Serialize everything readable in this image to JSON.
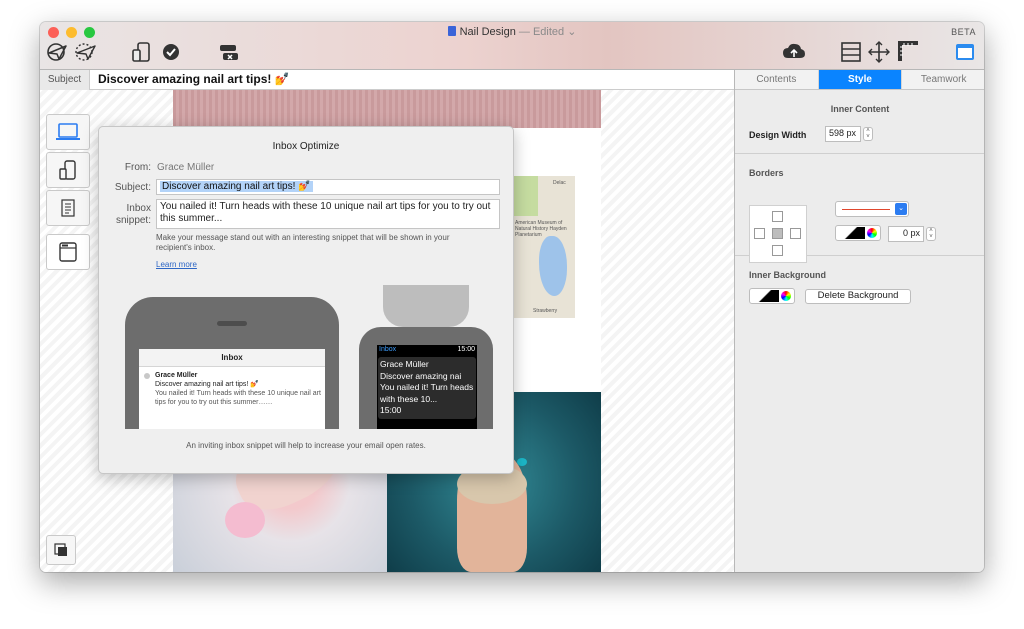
{
  "window": {
    "title": "Nail Design",
    "edited": "— Edited ⌄",
    "beta": "BETA"
  },
  "toolbar": {
    "icons": [
      "send-icon",
      "schedule-icon",
      "devices-icon",
      "check-icon",
      "spam-icon",
      "upload-cloud-icon",
      "layout-icon",
      "move-icon",
      "ruler-icon",
      "window-icon"
    ]
  },
  "subject_bar": {
    "label": "Subject",
    "text": "Discover amazing nail art tips! 💅"
  },
  "popover": {
    "title": "Inbox Optimize",
    "from_label": "From:",
    "from_value": "Grace Müller",
    "subject_label": "Subject:",
    "subject_value": "Discover amazing nail art tips! 💅",
    "snippet_label_1": "Inbox",
    "snippet_label_2": "snippet:",
    "snippet_value": "You nailed it! Turn heads with these 10 unique nail art tips for you to try out this summer...",
    "help": "Make your message stand out with an interesting snippet that will be shown in your recipient's inbox.",
    "learn_more": "Learn more",
    "footer": "An inviting inbox snippet will help to increase your email open rates."
  },
  "phone_preview": {
    "header": "Inbox",
    "sender": "Grace Müller",
    "subject": "Discover amazing nail art tips! 💅",
    "snippet": "You nailed it! Turn heads with these 10 unique nail art tips for you to try out this summer……"
  },
  "watch_preview": {
    "label": "Inbox",
    "time": "15:00",
    "message": "Grace Müller\nDiscover amazing nai\nYou nailed it! Turn heads with these 10...\n15:00"
  },
  "map_labels": {
    "text": "American Museum of Natural History Hayden Planetarium",
    "top": "Delac",
    "bottom": "Strawberry"
  },
  "sidebar": {
    "tabs": [
      "Contents",
      "Style",
      "Teamwork"
    ],
    "active_tab": "Style",
    "inner_content": {
      "title": "Inner Content",
      "design_width_label": "Design Width",
      "design_width_value": "598 px"
    },
    "borders": {
      "title": "Borders",
      "line_color": "#e0462d",
      "border_width": "0 px"
    },
    "inner_background": {
      "title": "Inner Background",
      "delete_button": "Delete Background"
    }
  },
  "colors": {
    "accent": "#0a84ff",
    "selection": "#b3d3f8"
  }
}
